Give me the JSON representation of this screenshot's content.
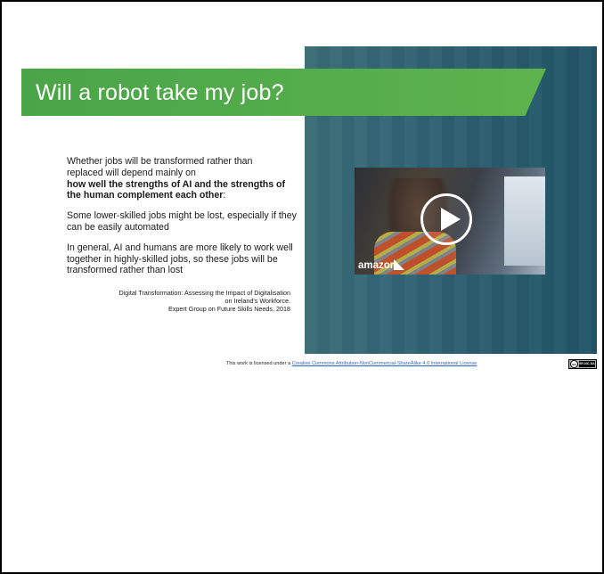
{
  "slide": {
    "title": "Will a robot take my job?",
    "paragraph1_line1": "Whether jobs will be transformed rather than",
    "paragraph1_line2": "replaced will depend mainly on",
    "paragraph1_bold": "how well the strengths of AI and the strengths of the human complement each other",
    "paragraph1_tail": ":",
    "paragraph2": "Some lower-skilled jobs might be lost, especially if they can be easily automated",
    "paragraph3": "In general, AI and humans are more likely to work well together in highly-skilled jobs, so these jobs will be transformed rather than lost",
    "citation_line1": "Digital Transformation: Assessing the Impact of Digitalisation",
    "citation_line2": "on Ireland's Workforce.",
    "citation_line3": "Expert Group on Future Skills Needs, 2018"
  },
  "video": {
    "brand": "amazon",
    "play_icon": "play-icon"
  },
  "license": {
    "prefix": "This work is licensed under a ",
    "link_text": "Creative Commons Attribution-NonCommercial-ShareAlike 4.0 International License",
    "badge_cc": "cc",
    "badge_text": "BY-NC-SA"
  },
  "colors": {
    "title_band": "#4aa548",
    "right_panel": "#2a5d6f",
    "link": "#3066c7"
  }
}
